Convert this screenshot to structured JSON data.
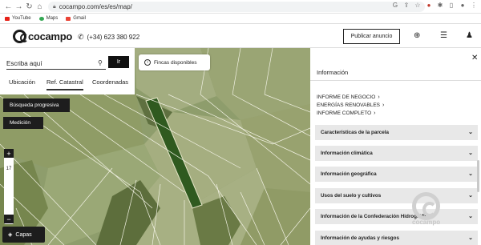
{
  "browser": {
    "url": "cocampo.com/es/es/map/",
    "bookmarks": [
      {
        "label": "YouTube",
        "color": "#e62117"
      },
      {
        "label": "Maps",
        "color": "#34a853"
      },
      {
        "label": "Gmail",
        "color": "#ea4335"
      }
    ]
  },
  "header": {
    "brand": "cocampo",
    "phone": "(+34) 623 380 922",
    "publish_label": "Publicar anuncio"
  },
  "search": {
    "placeholder": "Escriba aquí",
    "go_label": "Ir",
    "tabs": [
      "Ubicación",
      "Ref. Catastral",
      "Coordenadas"
    ],
    "active_tab": "Ref. Catastral"
  },
  "map": {
    "fincas_label": "Fincas disponibles",
    "progressive_search_label": "Búsqueda progresiva",
    "measure_label": "Medición",
    "zoom_in": "+",
    "zoom_level": "17",
    "zoom_out": "−",
    "layers_label": "Capas"
  },
  "panel": {
    "title": "Información",
    "links": [
      "INFORME DE NEGOCIO",
      "ENERGÍAS RENOVABLES",
      "INFORME COMPLETO"
    ],
    "sections": [
      "Características de la parcela",
      "Información climática",
      "Información geográfica",
      "Usos del suelo y cultivos",
      "Información de la Confederación Hidrográfica",
      "Información de ayudas y riesgos"
    ],
    "watermark": "cocampo"
  },
  "colors": {
    "dark": "#1d1d1d",
    "accordion_bg": "#e8e8e8",
    "highlight_parcel": "#2f5a1f",
    "field_light": "#a9b388",
    "field_dark": "#6b7b4a"
  }
}
